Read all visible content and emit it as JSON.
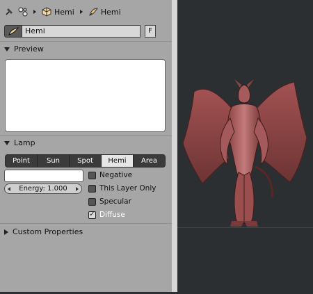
{
  "breadcrumb": {
    "items": [
      {
        "label": "",
        "icon": "pin-icon"
      },
      {
        "label": "",
        "icon": "scene-icon"
      },
      {
        "label": "Hemi",
        "icon": "cube-icon"
      },
      {
        "label": "Hemi",
        "icon": "lamp-icon"
      }
    ]
  },
  "datablock": {
    "name": "Hemi",
    "fake_user_label": "F",
    "icon": "lamp-icon"
  },
  "preview": {
    "title": "Preview"
  },
  "lamp": {
    "title": "Lamp",
    "types": [
      "Point",
      "Sun",
      "Spot",
      "Hemi",
      "Area"
    ],
    "active_type": "Hemi",
    "energy_label": "Energy: 1.000",
    "options": [
      {
        "label": "Negative",
        "checked": false
      },
      {
        "label": "This Layer Only",
        "checked": false
      },
      {
        "label": "Specular",
        "checked": false
      },
      {
        "label": "Diffuse",
        "checked": true
      }
    ]
  },
  "custom_properties": {
    "title": "Custom Properties"
  },
  "colors": {
    "panel_bg": "#a6a6a6",
    "viewport_bg": "#2b2f31",
    "model_red": "#9a4b4b"
  }
}
